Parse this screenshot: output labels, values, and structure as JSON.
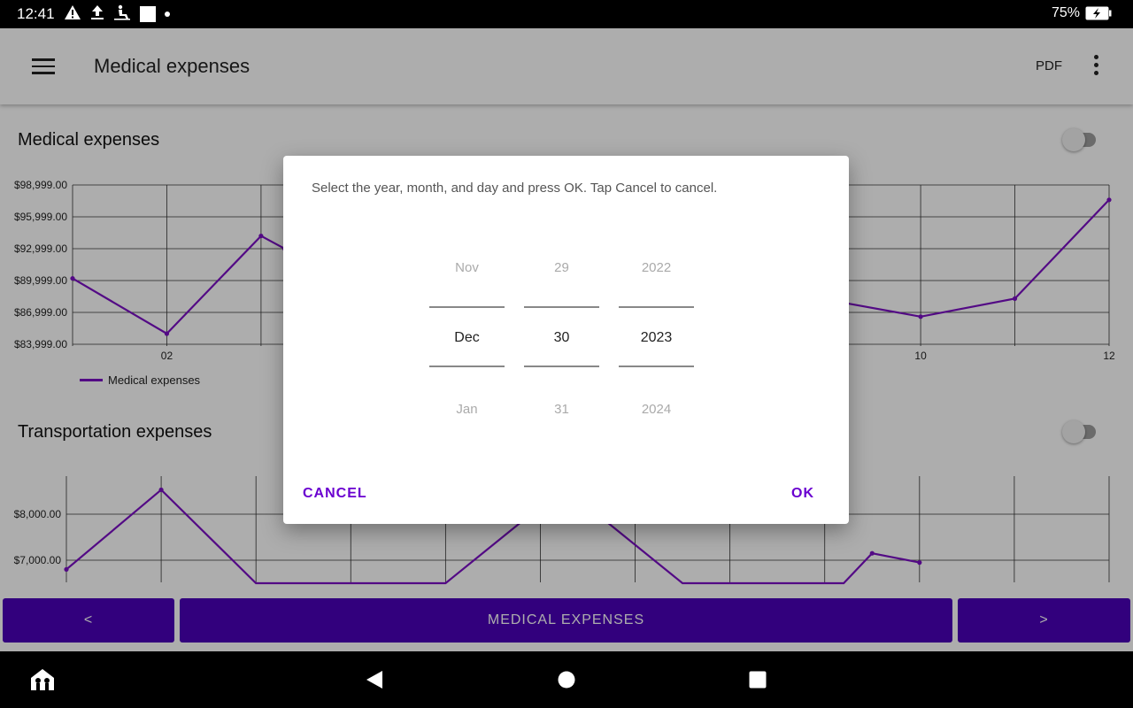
{
  "status_bar": {
    "time": "12:41",
    "battery": "75%"
  },
  "app_bar": {
    "title": "Medical expenses",
    "pdf_label": "PDF"
  },
  "sections": {
    "medical": {
      "title": "Medical expenses",
      "legend": "Medical expenses"
    },
    "transport": {
      "title": "Transportation expenses"
    }
  },
  "chart_data": [
    {
      "type": "line",
      "title": "Medical expenses",
      "series": [
        {
          "name": "Medical expenses",
          "color": "#7b0fc4",
          "points": [
            [
              1,
              90200
            ],
            [
              2,
              85000
            ],
            [
              3,
              94200
            ],
            [
              3.25,
              93000
            ],
            [
              9,
              88200
            ],
            [
              10,
              86600
            ],
            [
              11,
              88300
            ],
            [
              12,
              97600
            ]
          ]
        }
      ],
      "y_ticks": [
        "$98,999.00",
        "$95,999.00",
        "$92,999.00",
        "$89,999.00",
        "$86,999.00",
        "$83,999.00"
      ],
      "x_ticks": [
        "02",
        "10",
        "12"
      ],
      "ylim": [
        83999,
        98999
      ],
      "grid": true
    },
    {
      "type": "line",
      "title": "Transportation expenses",
      "series": [
        {
          "color": "#7b0fc4",
          "points": [
            [
              1,
              6800
            ],
            [
              2,
              8530
            ],
            [
              3,
              6500
            ],
            [
              5,
              6500
            ],
            [
              5.9,
              8000
            ],
            [
              6.6,
              8000
            ],
            [
              7.5,
              6500
            ],
            [
              9.2,
              6500
            ],
            [
              9.5,
              7150
            ],
            [
              10,
              6950
            ]
          ]
        }
      ],
      "y_ticks": [
        "$8,000.00",
        "$7,000.00"
      ],
      "grid": true
    }
  ],
  "bottom_nav": {
    "prev": "<",
    "center": "MEDICAL EXPENSES",
    "next": ">"
  },
  "dialog": {
    "message": "Select the year, month, and day and press OK. Tap Cancel to cancel.",
    "month": {
      "prev": "Nov",
      "current": "Dec",
      "next": "Jan"
    },
    "day": {
      "prev": "29",
      "current": "30",
      "next": "31"
    },
    "year": {
      "prev": "2022",
      "current": "2023",
      "next": "2024"
    },
    "cancel": "CANCEL",
    "ok": "OK"
  }
}
